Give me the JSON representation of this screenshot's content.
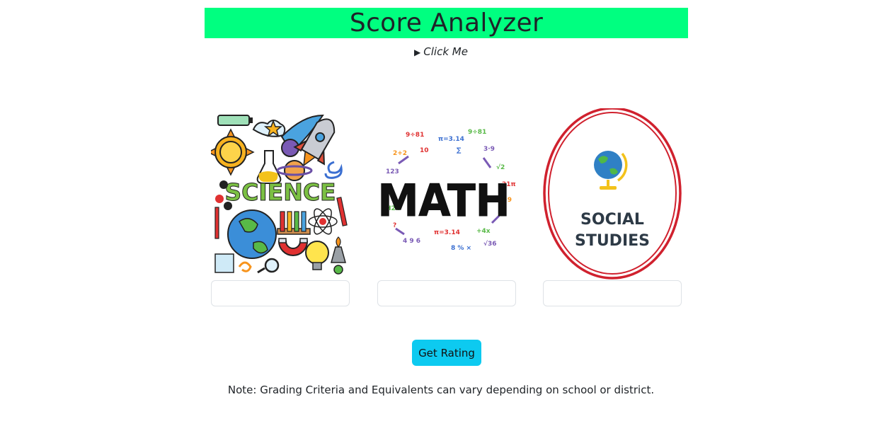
{
  "header": {
    "title": "Score Analyzer"
  },
  "details": {
    "summary": "Click Me",
    "marker": "▶"
  },
  "subjects": [
    {
      "name": "science",
      "image_text": "SCIENCE",
      "score_value": ""
    },
    {
      "name": "math",
      "image_text": "MATH",
      "score_value": ""
    },
    {
      "name": "social-studies",
      "image_text_line1": "SOCIAL",
      "image_text_line2": "STUDIES",
      "score_value": ""
    }
  ],
  "actions": {
    "get_rating_label": "Get Rating"
  },
  "footer": {
    "note": "Note: Grading Criteria and Equivalents can vary depending on school or district."
  },
  "colors": {
    "header_bg": "#00ff80",
    "button_bg": "#0dcaf0",
    "social_ring": "#d0212e"
  }
}
